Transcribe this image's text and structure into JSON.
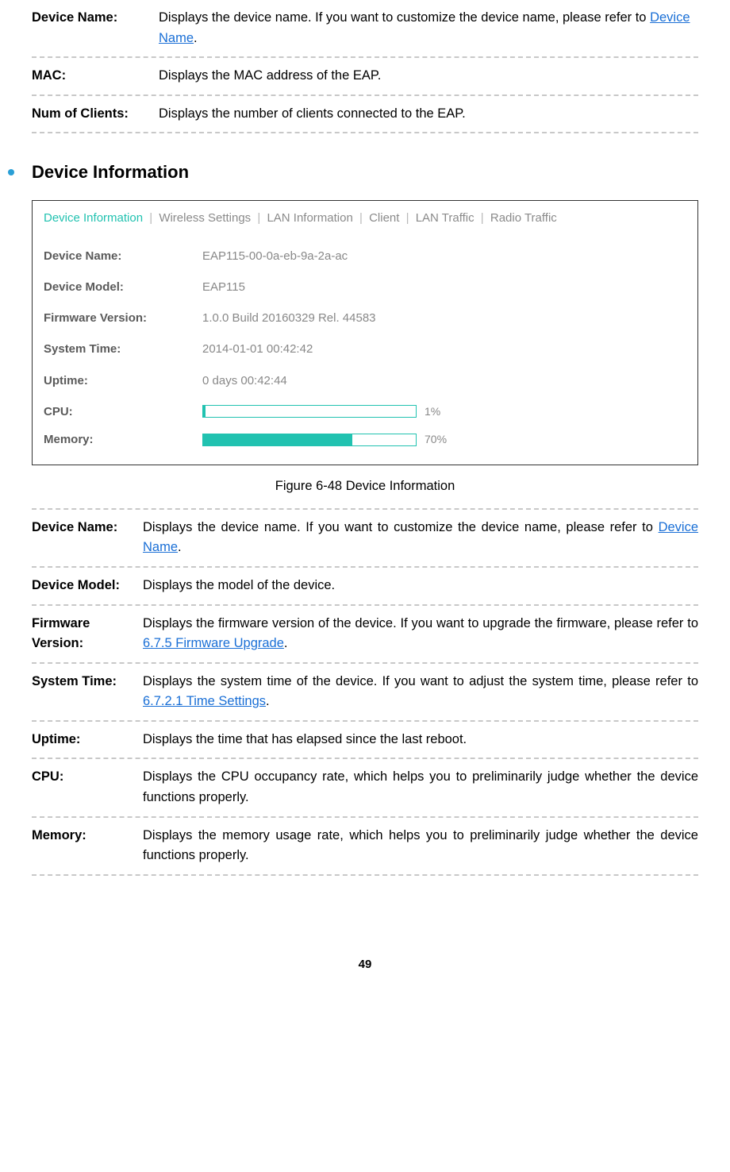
{
  "top_table": {
    "device_name_label": "Device Name:",
    "device_name_desc_before": "Displays the device name. If you want to customize the device name, please refer to ",
    "device_name_link": "Device Name",
    "device_name_desc_after": ".",
    "mac_label": "MAC:",
    "mac_desc": "Displays the MAC address of the EAP.",
    "num_clients_label": "Num of Clients:",
    "num_clients_desc": "Displays the number of clients connected to the EAP."
  },
  "section_title": "Device Information",
  "panel": {
    "tabs": {
      "active": "Device Information",
      "t2": "Wireless Settings",
      "t3": "LAN Information",
      "t4": "Client",
      "t5": "LAN Traffic",
      "t6": "Radio Traffic"
    },
    "rows": {
      "device_name_label": "Device Name:",
      "device_name_value": "EAP115-00-0a-eb-9a-2a-ac",
      "device_model_label": "Device Model:",
      "device_model_value": "EAP115",
      "firmware_label": "Firmware Version:",
      "firmware_value": "1.0.0 Build 20160329 Rel. 44583",
      "system_time_label": "System Time:",
      "system_time_value": "2014-01-01 00:42:42",
      "uptime_label": "Uptime:",
      "uptime_value": "0 days 00:42:44",
      "cpu_label": "CPU:",
      "cpu_pct_text": "1%",
      "cpu_pct_width": "1%",
      "memory_label": "Memory:",
      "memory_pct_text": "70%",
      "memory_pct_width": "70%"
    }
  },
  "figure_caption": "Figure 6-48 Device Information",
  "table2": {
    "device_name_label": "Device Name:",
    "device_name_desc_before": "Displays the device name. If you want to customize the device name, please refer to ",
    "device_name_link": "Device Name",
    "device_name_desc_after": ".",
    "device_model_label": "Device Model:",
    "device_model_desc": "Displays the model of the device.",
    "firmware_label": "Firmware Version:",
    "firmware_desc_before": "Displays the firmware version of the device. If you want to upgrade the firmware, please refer to ",
    "firmware_link": "6.7.5 Firmware Upgrade",
    "firmware_desc_after": ".",
    "system_time_label": "System Time:",
    "system_time_desc_before": "Displays the system time of the device. If you want to adjust the system time, please refer to ",
    "system_time_link": "6.7.2.1 Time Settings",
    "system_time_desc_after": ".",
    "uptime_label": "Uptime:",
    "uptime_desc": "Displays the time that has elapsed since the last reboot.",
    "cpu_label": "CPU:",
    "cpu_desc": "Displays the CPU occupancy rate, which helps you to preliminarily judge whether the device functions properly.",
    "memory_label": "Memory:",
    "memory_desc": "Displays the memory usage rate, which helps you to preliminarily judge whether the device functions properly."
  },
  "page_number": "49"
}
